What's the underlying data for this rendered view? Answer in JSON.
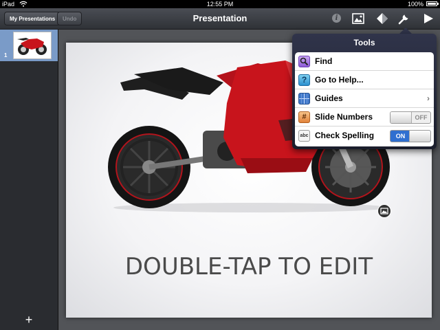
{
  "status_bar": {
    "device": "iPad",
    "time": "12:55 PM",
    "battery": "100%"
  },
  "toolbar": {
    "my_presentations_label": "My Presentations",
    "undo_label": "Undo",
    "title": "Presentation",
    "icons": [
      "info-icon",
      "media-icon",
      "animation-icon",
      "tools-icon",
      "play-icon"
    ]
  },
  "navigator": {
    "slides": [
      {
        "number": "1"
      }
    ],
    "add_label": "+"
  },
  "slide": {
    "placeholder_text": "DOUBLE-TAP TO EDIT"
  },
  "tools_popover": {
    "title": "Tools",
    "items": [
      {
        "label": "Find",
        "icon": "magnifier-icon"
      },
      {
        "label": "Go to Help...",
        "icon": "help-icon"
      },
      {
        "label": "Guides",
        "icon": "guides-icon",
        "accessory": "›"
      },
      {
        "label": "Slide Numbers",
        "icon": "slide-number-icon",
        "switch": "OFF"
      },
      {
        "label": "Check Spelling",
        "icon": "spelling-icon",
        "switch": "ON"
      }
    ]
  },
  "colors": {
    "toolbar": "#3a3d42",
    "popover": "#262a3a",
    "switch_on": "#2f6fd0",
    "motorcycle": "#c8141c"
  }
}
